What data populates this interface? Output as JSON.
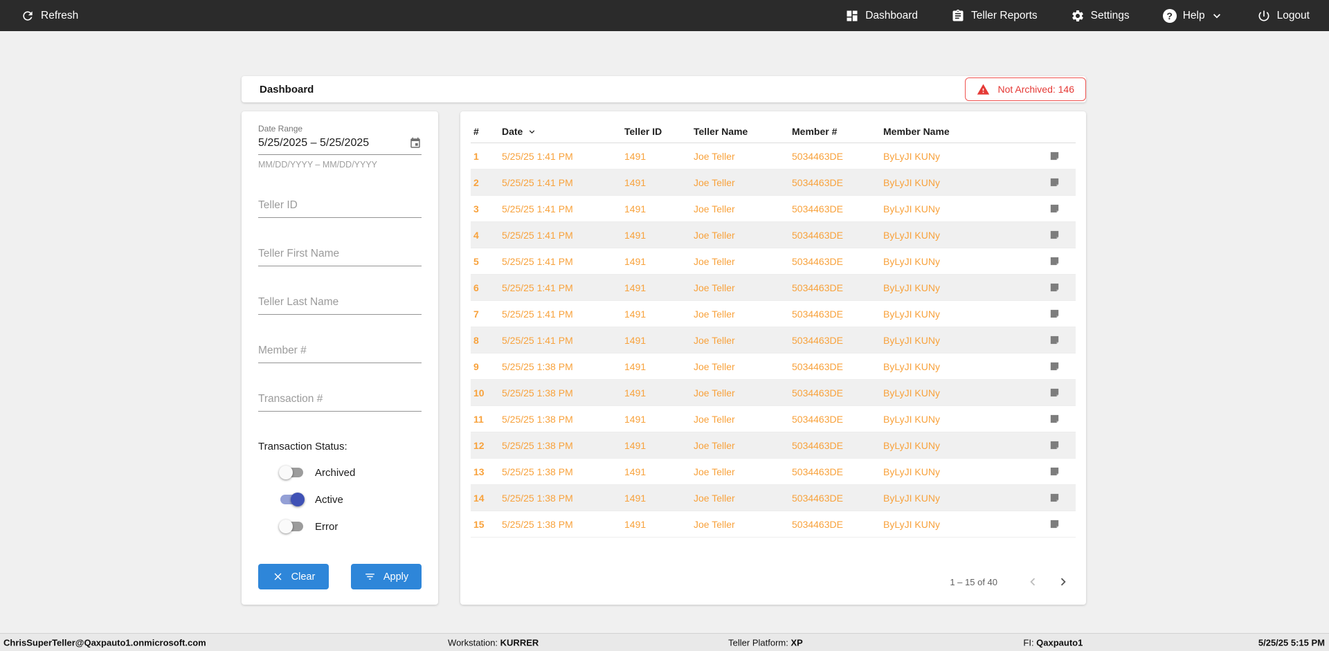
{
  "colors": {
    "accent_blue": "#2e86d9",
    "row_orange": "#f8a23c",
    "alert_red": "#e53935",
    "toggle_indigo": "#3f51b5",
    "nav_bg": "#2b2b2b"
  },
  "nav": {
    "refresh_label": "Refresh",
    "items": [
      {
        "label": "Dashboard"
      },
      {
        "label": "Teller Reports"
      },
      {
        "label": "Settings"
      },
      {
        "label": "Help"
      },
      {
        "label": "Logout"
      }
    ]
  },
  "header": {
    "title": "Dashboard",
    "alert_label": "Not Archived: 146"
  },
  "filters": {
    "date_range": {
      "label": "Date Range",
      "value": "5/25/2025 – 5/25/2025",
      "hint": "MM/DD/YYYY – MM/DD/YYYY"
    },
    "inputs": [
      {
        "placeholder": "Teller ID"
      },
      {
        "placeholder": "Teller First Name"
      },
      {
        "placeholder": "Teller Last Name"
      },
      {
        "placeholder": "Member #"
      },
      {
        "placeholder": "Transaction #"
      }
    ],
    "status": {
      "label": "Transaction Status:",
      "toggles": [
        {
          "label": "Archived",
          "on": false
        },
        {
          "label": "Active",
          "on": true
        },
        {
          "label": "Error",
          "on": false
        }
      ]
    },
    "clear_label": "Clear",
    "apply_label": "Apply"
  },
  "table": {
    "columns": {
      "num": "#",
      "date": "Date",
      "teller_id": "Teller ID",
      "teller_name": "Teller Name",
      "member_num": "Member #",
      "member_name": "Member Name"
    },
    "sorted_by": "Date",
    "rows": [
      {
        "num": "1",
        "date": "5/25/25 1:41 PM",
        "teller_id": "1491",
        "teller_name": "Joe Teller",
        "member_num": "5034463DE",
        "member_name": "ByLyJI KUNy"
      },
      {
        "num": "2",
        "date": "5/25/25 1:41 PM",
        "teller_id": "1491",
        "teller_name": "Joe Teller",
        "member_num": "5034463DE",
        "member_name": "ByLyJI KUNy"
      },
      {
        "num": "3",
        "date": "5/25/25 1:41 PM",
        "teller_id": "1491",
        "teller_name": "Joe Teller",
        "member_num": "5034463DE",
        "member_name": "ByLyJI KUNy"
      },
      {
        "num": "4",
        "date": "5/25/25 1:41 PM",
        "teller_id": "1491",
        "teller_name": "Joe Teller",
        "member_num": "5034463DE",
        "member_name": "ByLyJI KUNy"
      },
      {
        "num": "5",
        "date": "5/25/25 1:41 PM",
        "teller_id": "1491",
        "teller_name": "Joe Teller",
        "member_num": "5034463DE",
        "member_name": "ByLyJI KUNy"
      },
      {
        "num": "6",
        "date": "5/25/25 1:41 PM",
        "teller_id": "1491",
        "teller_name": "Joe Teller",
        "member_num": "5034463DE",
        "member_name": "ByLyJI KUNy"
      },
      {
        "num": "7",
        "date": "5/25/25 1:41 PM",
        "teller_id": "1491",
        "teller_name": "Joe Teller",
        "member_num": "5034463DE",
        "member_name": "ByLyJI KUNy"
      },
      {
        "num": "8",
        "date": "5/25/25 1:41 PM",
        "teller_id": "1491",
        "teller_name": "Joe Teller",
        "member_num": "5034463DE",
        "member_name": "ByLyJI KUNy"
      },
      {
        "num": "9",
        "date": "5/25/25 1:38 PM",
        "teller_id": "1491",
        "teller_name": "Joe Teller",
        "member_num": "5034463DE",
        "member_name": "ByLyJI KUNy"
      },
      {
        "num": "10",
        "date": "5/25/25 1:38 PM",
        "teller_id": "1491",
        "teller_name": "Joe Teller",
        "member_num": "5034463DE",
        "member_name": "ByLyJI KUNy"
      },
      {
        "num": "11",
        "date": "5/25/25 1:38 PM",
        "teller_id": "1491",
        "teller_name": "Joe Teller",
        "member_num": "5034463DE",
        "member_name": "ByLyJI KUNy"
      },
      {
        "num": "12",
        "date": "5/25/25 1:38 PM",
        "teller_id": "1491",
        "teller_name": "Joe Teller",
        "member_num": "5034463DE",
        "member_name": "ByLyJI KUNy"
      },
      {
        "num": "13",
        "date": "5/25/25 1:38 PM",
        "teller_id": "1491",
        "teller_name": "Joe Teller",
        "member_num": "5034463DE",
        "member_name": "ByLyJI KUNy"
      },
      {
        "num": "14",
        "date": "5/25/25 1:38 PM",
        "teller_id": "1491",
        "teller_name": "Joe Teller",
        "member_num": "5034463DE",
        "member_name": "ByLyJI KUNy"
      },
      {
        "num": "15",
        "date": "5/25/25 1:38 PM",
        "teller_id": "1491",
        "teller_name": "Joe Teller",
        "member_num": "5034463DE",
        "member_name": "ByLyJI KUNy"
      }
    ],
    "pagination": {
      "label": "1 – 15 of 40"
    }
  },
  "footer": {
    "user": "ChrisSuperTeller@Qaxpauto1.onmicrosoft.com",
    "workstation_label": "Workstation: ",
    "workstation_value": "KURRER",
    "platform_label": "Teller Platform: ",
    "platform_value": "XP",
    "fi_label": "FI: ",
    "fi_value": "Qaxpauto1",
    "datetime": "5/25/25 5:15 PM"
  }
}
